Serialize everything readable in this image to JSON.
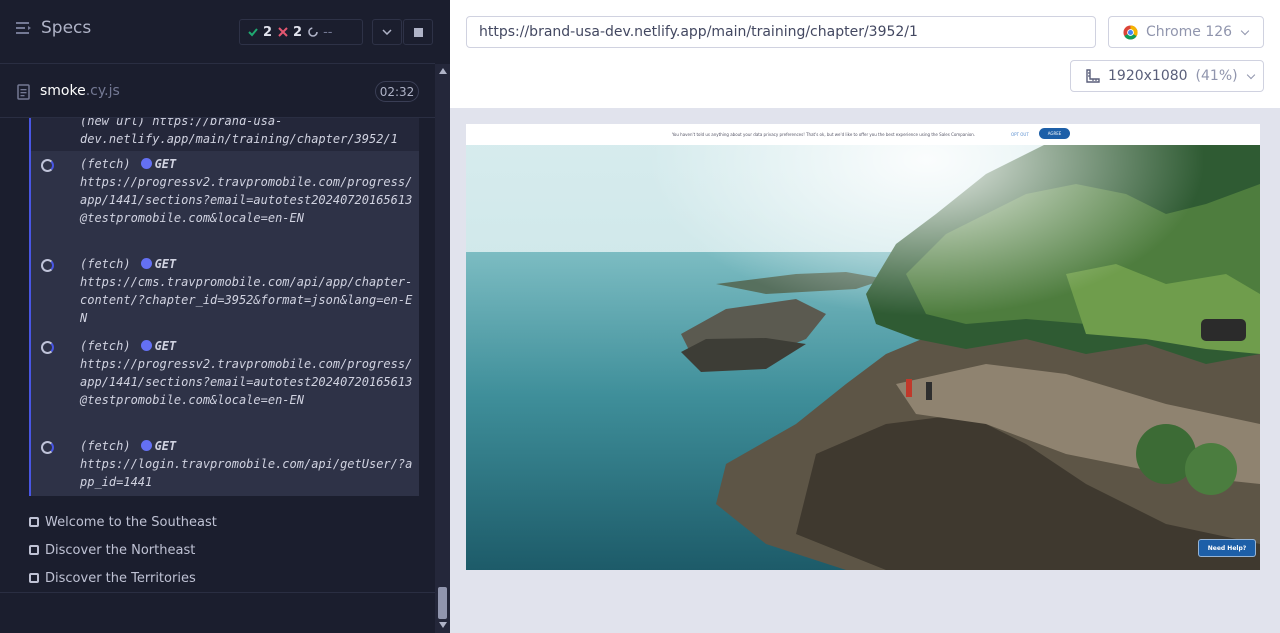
{
  "reporter": {
    "title": "Specs",
    "stats": {
      "passed": "2",
      "failed": "2",
      "pending": "--"
    },
    "spec": {
      "name": "smoke",
      "ext": ".cy.js",
      "duration": "02:32"
    },
    "log_cut": "(new url) https://brand-usa-dev.netlify.app/main/training/chapter/3952/1",
    "commands": [
      {
        "type": "(fetch)",
        "method": "GET",
        "url": "https://progressv2.travpromobile.com/progress/app/1441/sections?email=autotest20240720165613@testpromobile.com&locale=en-EN"
      },
      {
        "type": "(fetch)",
        "method": "GET",
        "url": "https://cms.travpromobile.com/api/app/chapter-content/?chapter_id=3952&format=json&lang=en-EN"
      },
      {
        "type": "(fetch)",
        "method": "GET",
        "url": "https://progressv2.travpromobile.com/progress/app/1441/sections?email=autotest20240720165613@testpromobile.com&locale=en-EN"
      },
      {
        "type": "(fetch)",
        "method": "GET",
        "url": "https://login.travpromobile.com/api/getUser/?app_id=1441"
      }
    ],
    "tests": [
      {
        "label": "Welcome to the Southeast"
      },
      {
        "label": "Discover the Northeast"
      },
      {
        "label": "Discover the Territories"
      }
    ]
  },
  "aut": {
    "url": "https://brand-usa-dev.netlify.app/main/training/chapter/3952/1",
    "browser": "Chrome 126",
    "viewport": "1920x1080",
    "zoom": "(41%)",
    "cookie_msg": "You haven't told us anything about your data privacy preferences! That's ok, but we'd like to offer you the best experience using the Sales Companion.",
    "cookie_optout": "OPT OUT",
    "cookie_agree": "AGREE",
    "help": "Need Help?"
  }
}
